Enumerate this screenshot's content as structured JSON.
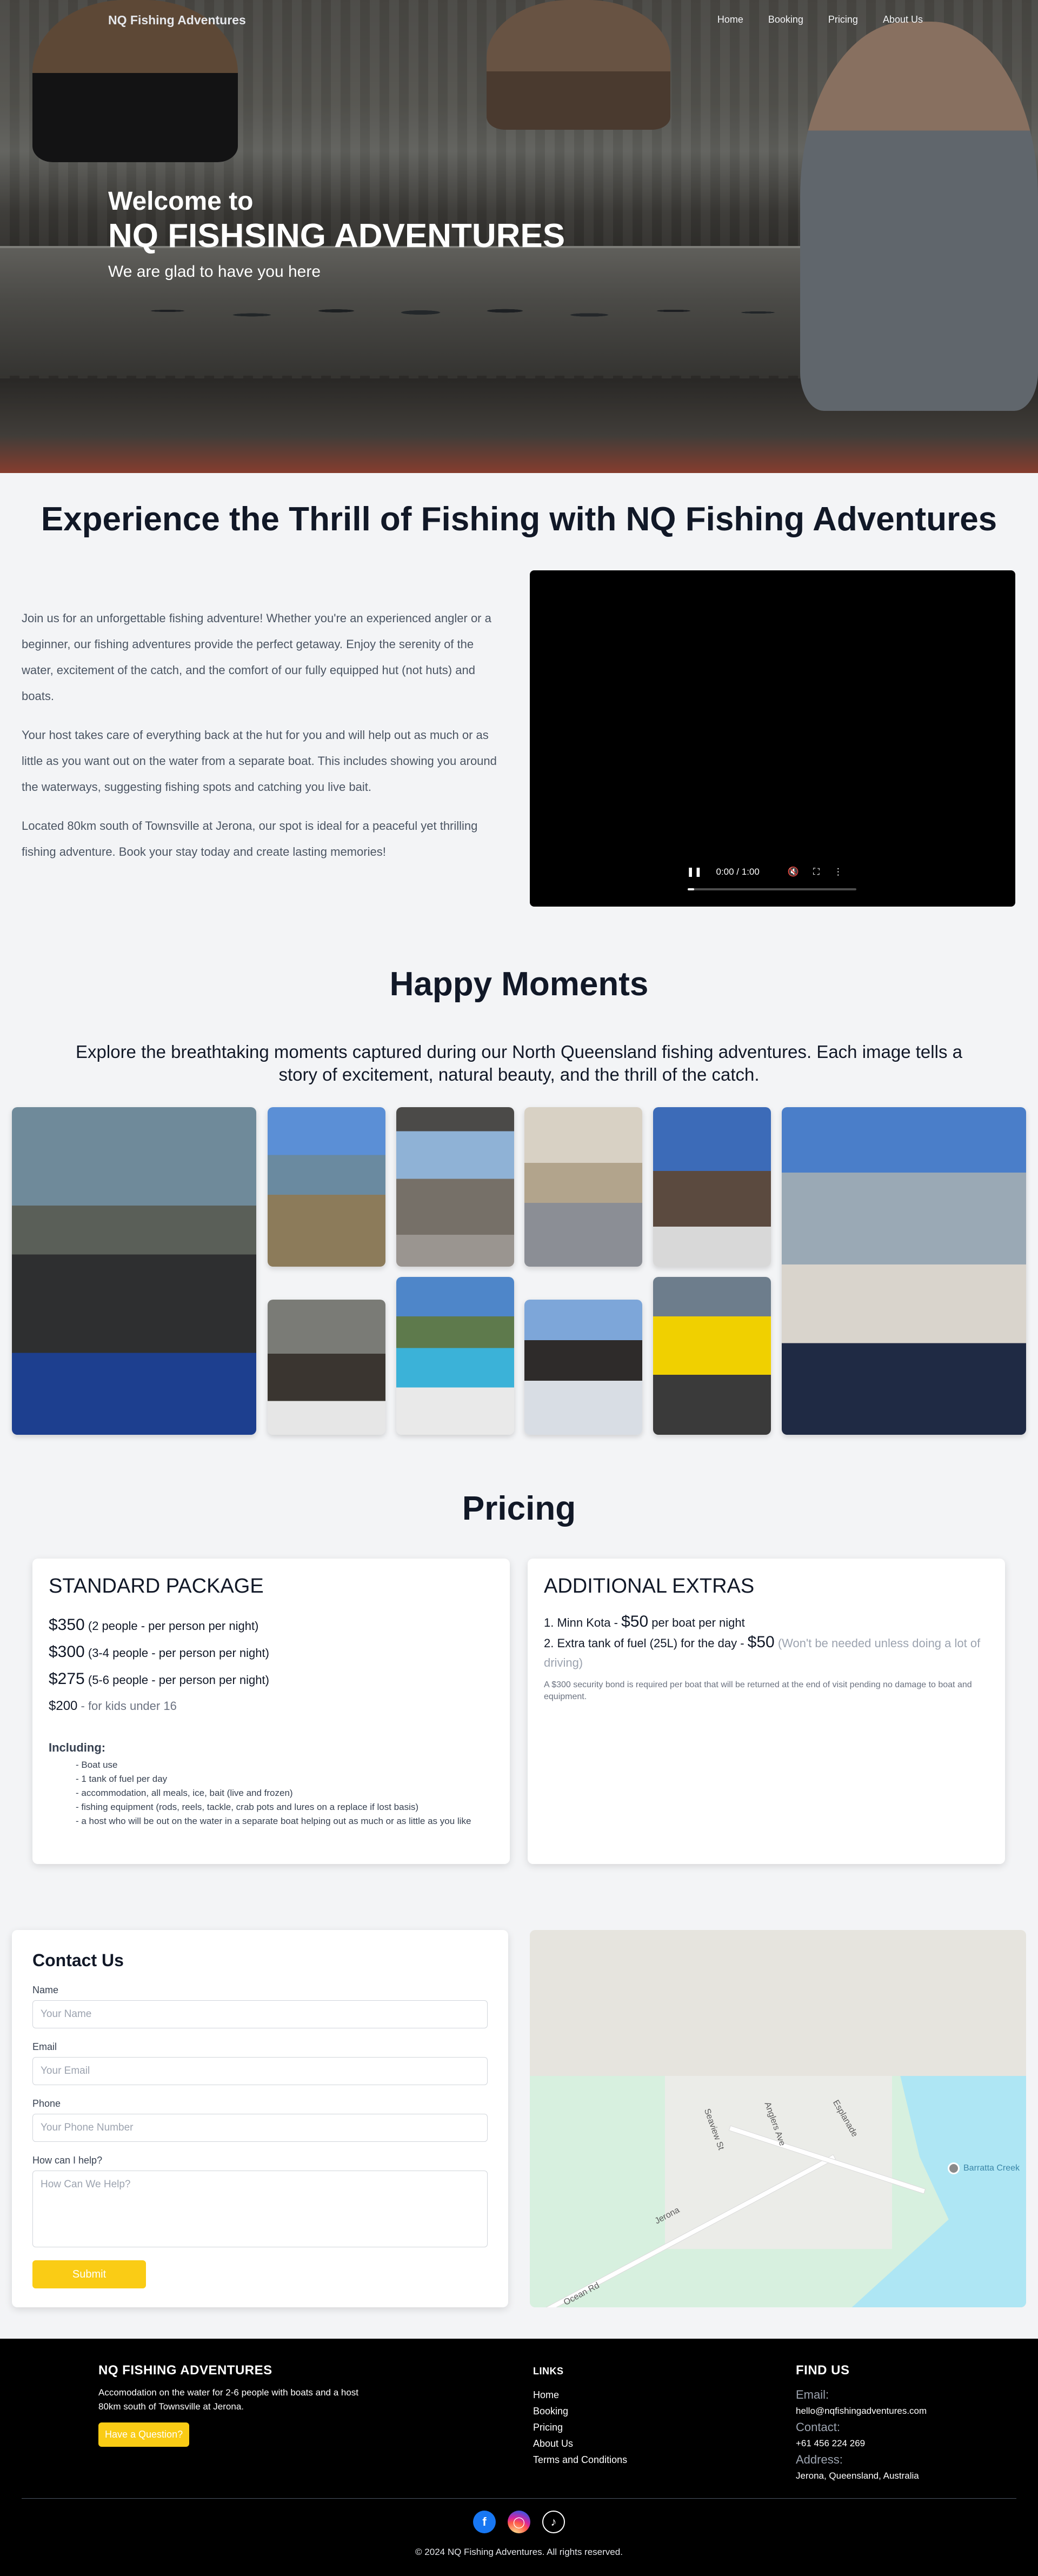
{
  "nav": {
    "brand": "NQ Fishing Adventures",
    "links": [
      "Home",
      "Booking",
      "Pricing",
      "About Us"
    ]
  },
  "hero": {
    "welcome": "Welcome to",
    "title": "NQ FISHSING ADVENTURES",
    "subtitle": "We are glad to have you here"
  },
  "experience": {
    "title": "Experience the Thrill of Fishing with NQ Fishing Adventures",
    "paragraphs": [
      "Join us for an unforgettable fishing adventure! Whether you're an experienced angler or a beginner, our fishing adventures provide the perfect getaway. Enjoy the serenity of the water, excitement of the catch, and the comfort of our fully equipped hut (not huts) and boats.",
      "Your host takes care of everything back at the hut for you and will help out as much or as little as you want out on the water from a separate boat. This includes showing you around the waterways, suggesting fishing spots and catching you live bait.",
      "Located 80km south of Townsville at Jerona, our spot is ideal for a peaceful yet thrilling fishing adventure. Book your stay today and create lasting memories!"
    ],
    "video": {
      "time": "0:00 / 1:00",
      "progress": 0.04
    }
  },
  "happy": {
    "title": "Happy Moments",
    "description": "Explore the breathtaking moments captured during our North Queensland fishing adventures. Each image tells a story of excitement, natural beauty, and the thrill of the catch."
  },
  "pricing": {
    "title": "Pricing",
    "standard": {
      "title": "STANDARD PACKAGE",
      "lines": [
        {
          "amount": "$350",
          "detail": " (2 people - per person per night)"
        },
        {
          "amount": "$300",
          "detail": " (3-4 people - per person per night)"
        },
        {
          "amount": "$275",
          "detail": " (5-6 people - per person per night)"
        },
        {
          "amount": "$200",
          "detail": " - for kids under 16"
        }
      ],
      "including_title": "Including:",
      "including": [
        "- Boat use",
        "- 1 tank of fuel per day",
        "- accommodation, all meals, ice, bait (live and frozen)",
        "- fishing equipment (rods, reels, tackle, crab pots and lures on a replace if lost basis)",
        "- a host who will be out on the water in a separate boat helping out as much or as little as you like"
      ]
    },
    "extras": {
      "title": "ADDITIONAL EXTRAS",
      "item1_prefix": "1. Minn Kota - ",
      "item1_amount": "$50",
      "item1_suffix": " per boat per night",
      "item2_prefix": "2. Extra tank of fuel (25L) for the day - ",
      "item2_amount": "$50",
      "item2_note": " (Won't be needed unless doing a lot of driving)",
      "bond": "A $300 security bond is required per boat that will be returned at the end of visit pending no damage to boat and equipment."
    }
  },
  "contact": {
    "title": "Contact Us",
    "name_label": "Name",
    "name_placeholder": "Your Name",
    "email_label": "Email",
    "email_placeholder": "Your Email",
    "phone_label": "Phone",
    "phone_placeholder": "Your Phone Number",
    "help_label": "How can I help?",
    "help_placeholder": "How Can We Help?",
    "submit": "Submit"
  },
  "map": {
    "labels": [
      "Jerona",
      "Barratta Creek",
      "Ocean Rd",
      "Esplanade",
      "Seaview St",
      "Anglers Ave"
    ]
  },
  "footer": {
    "brand": "NQ FISHING ADVENTURES",
    "about": "Accomodation on the water for 2-6 people with boats and a host 80km south of Townsville at Jerona.",
    "question_button": "Have a Question?",
    "links_title": "LINKS",
    "links": [
      "Home",
      "Booking",
      "Pricing",
      "About Us",
      "Terms and Conditions"
    ],
    "find_title": "FIND US",
    "email_label": "Email:",
    "email": "hello@nqfishingadventures.com",
    "contact_label": "Contact:",
    "phone": "+61 456 224 269",
    "address_label": "Address:",
    "address": "Jerona, Queensland, Australia",
    "copyright": "© 2024 NQ Fishing Adventures. All rights reserved.",
    "social_icons": [
      "facebook-icon",
      "instagram-icon",
      "tiktok-icon"
    ]
  },
  "colors": {
    "accent_yellow": "#facc15",
    "footer_bg": "#000000",
    "page_bg": "#f3f4f6"
  }
}
